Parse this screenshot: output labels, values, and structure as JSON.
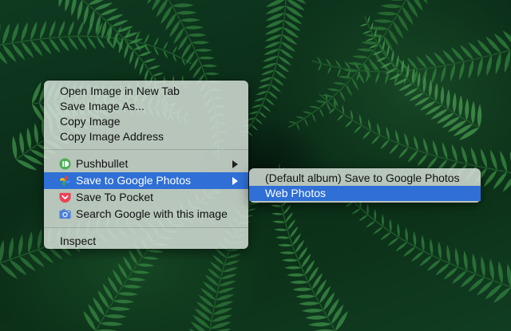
{
  "context_menu": {
    "items": [
      {
        "label": "Open Image in New Tab"
      },
      {
        "label": "Save Image As..."
      },
      {
        "label": "Copy Image"
      },
      {
        "label": "Copy Image Address"
      },
      {
        "label": "Pushbullet",
        "icon": "pushbullet-icon",
        "submenu": true
      },
      {
        "label": "Save to Google Photos",
        "icon": "google-photos-icon",
        "submenu": true,
        "highlighted": true
      },
      {
        "label": "Save To Pocket",
        "icon": "pocket-icon"
      },
      {
        "label": "Search Google with this image",
        "icon": "camera-search-icon"
      },
      {
        "label": "Inspect"
      }
    ]
  },
  "submenu": {
    "items": [
      {
        "label": "(Default album) Save to Google Photos"
      },
      {
        "label": "Web Photos",
        "highlighted": true
      }
    ]
  },
  "colors": {
    "highlight": "#2f6fd6",
    "menu_background": "#d4ded6",
    "pushbullet": "#4cae54",
    "pocket": "#ee4056"
  }
}
